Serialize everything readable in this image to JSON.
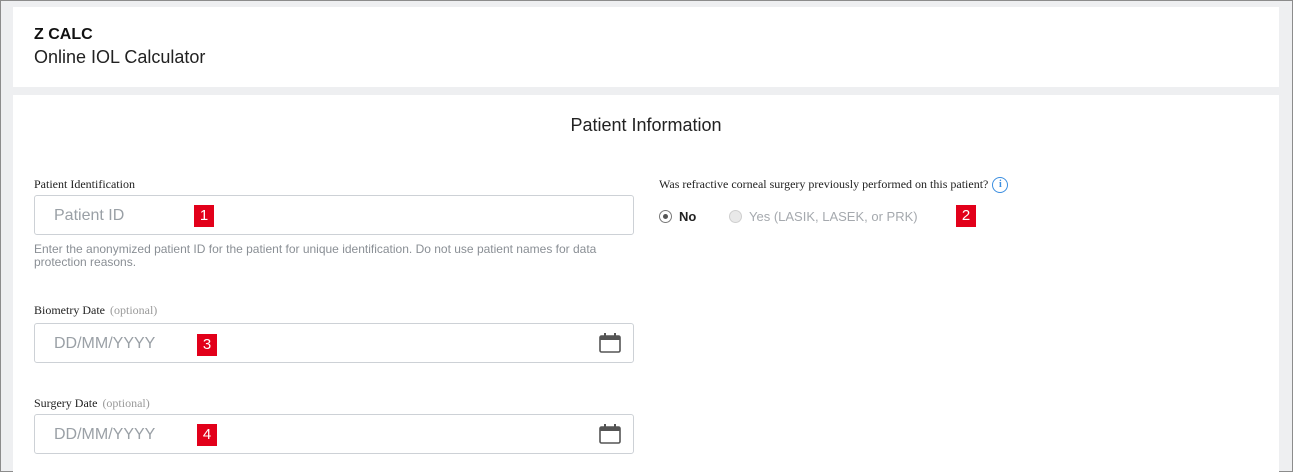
{
  "app": {
    "name": "Z CALC",
    "subtitle": "Online IOL Calculator"
  },
  "section": {
    "title": "Patient Information"
  },
  "patient_id": {
    "label": "Patient Identification",
    "placeholder": "Patient ID",
    "help": "Enter the anonymized patient ID for the patient for unique identification. Do not use patient names for data protection reasons.",
    "marker": "1"
  },
  "refractive_surgery": {
    "question": "Was refractive corneal surgery previously performed on this patient?",
    "info_glyph": "i",
    "options": [
      {
        "label": "No",
        "selected": true
      },
      {
        "label": "Yes (LASIK, LASEK, or PRK)",
        "selected": false
      }
    ],
    "marker": "2"
  },
  "biometry_date": {
    "label": "Biometry Date",
    "optional": "(optional)",
    "placeholder": "DD/MM/YYYY",
    "icon": "calendar-icon",
    "marker": "3"
  },
  "surgery_date": {
    "label": "Surgery Date",
    "optional": "(optional)",
    "placeholder": "DD/MM/YYYY",
    "icon": "calendar-icon",
    "marker": "4"
  },
  "colors": {
    "marker": "#e2001a",
    "info": "#3b8ee0",
    "page_bg": "#eeeff1"
  }
}
